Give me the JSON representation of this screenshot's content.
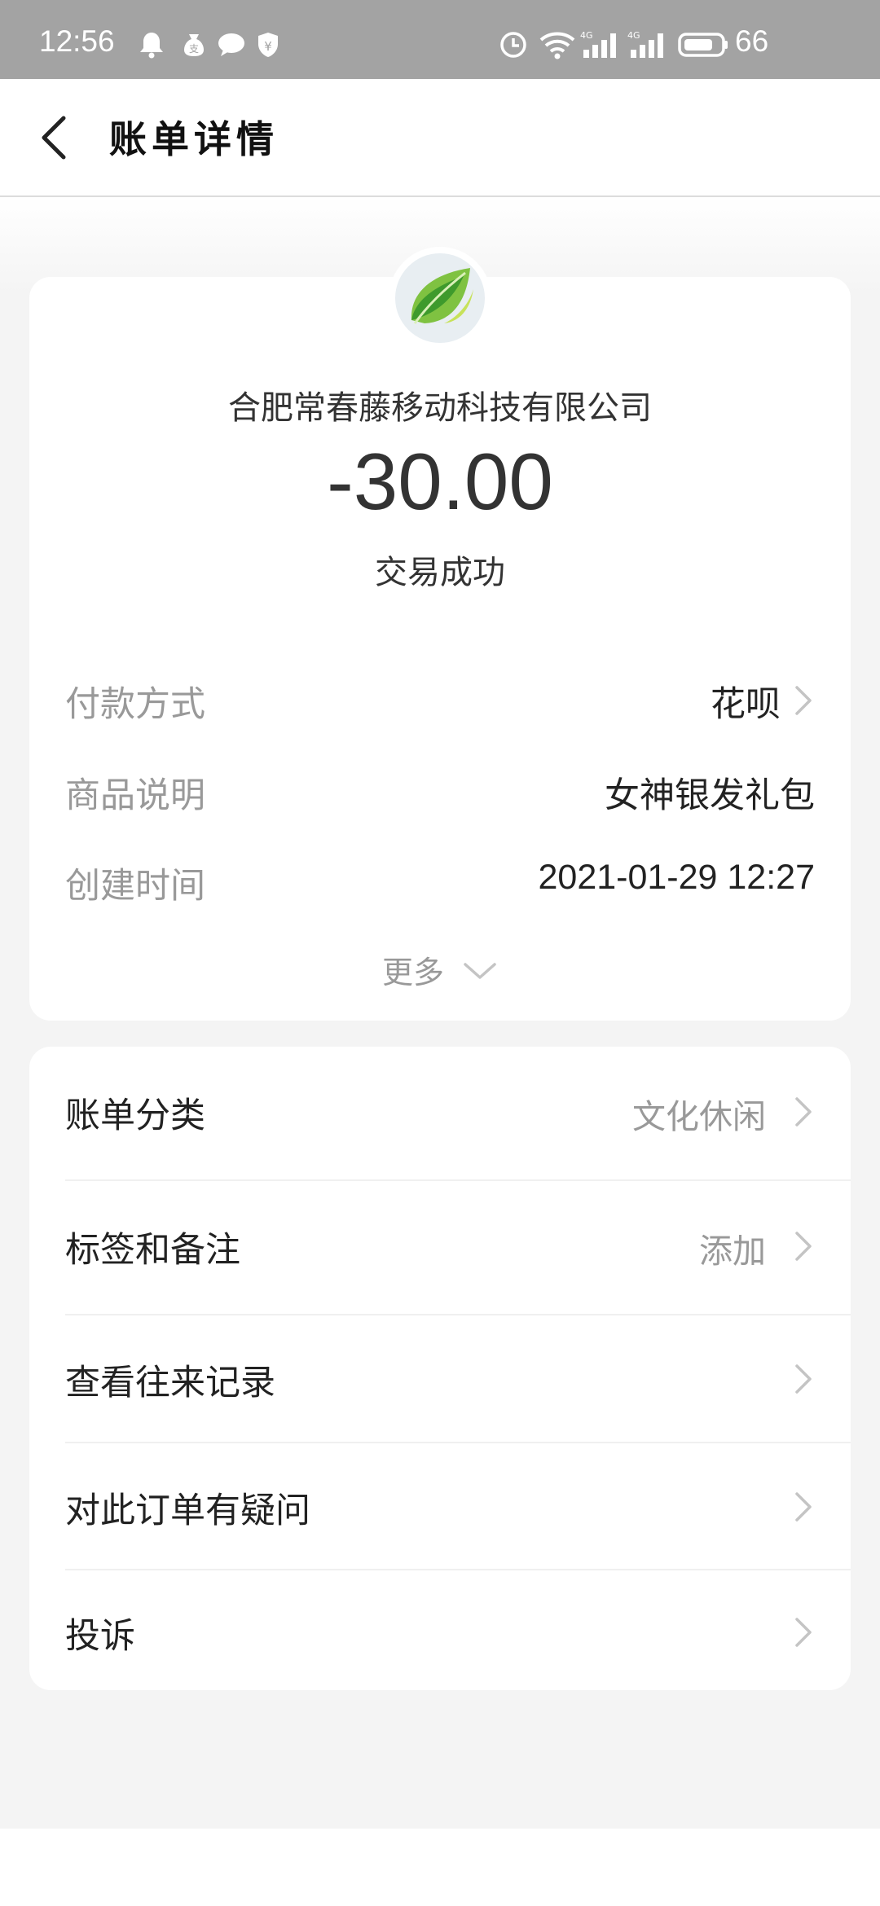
{
  "status_bar": {
    "time": "12:56",
    "network_1": "4G",
    "network_2": "4G",
    "battery": "66"
  },
  "header": {
    "title": "账单详情"
  },
  "bill": {
    "merchant": "合肥常春藤移动科技有限公司",
    "amount": "-30.00",
    "status": "交易成功",
    "details": [
      {
        "label": "付款方式",
        "value": "花呗"
      },
      {
        "label": "商品说明",
        "value": "女神银发礼包"
      },
      {
        "label": "创建时间",
        "value": "2021-01-29 12:27"
      }
    ],
    "more_label": "更多"
  },
  "actions": {
    "category_label": "账单分类",
    "category_value": "文化休闲",
    "tags_label": "标签和备注",
    "tags_value": "添加",
    "history_label": "查看往来记录",
    "question_label": "对此订单有疑问",
    "complaint_label": "投诉"
  },
  "colors": {
    "status_bar": "#a3a3a3",
    "page_bg": "#f4f4f4",
    "card_bg": "#ffffff",
    "leaf_green": "#5aa82a"
  }
}
